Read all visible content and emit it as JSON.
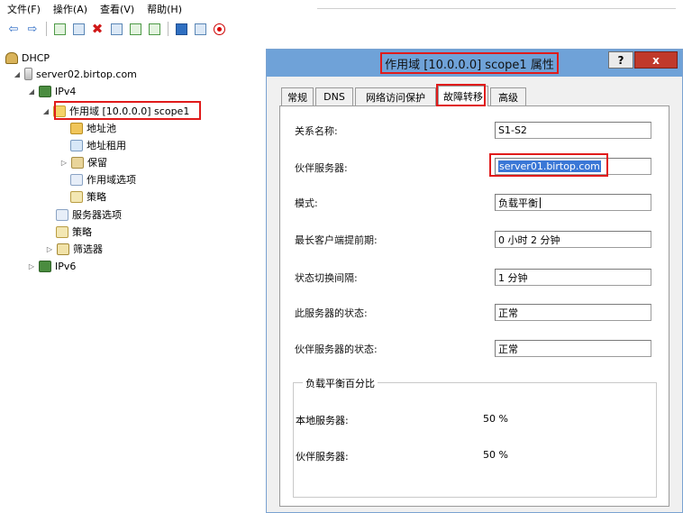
{
  "menu": [
    "文件(F)",
    "操作(A)",
    "查看(V)",
    "帮助(H)"
  ],
  "toolbar": {
    "icons": [
      "back-icon",
      "forward-icon",
      "up-folder-icon",
      "show-hide-tree-icon",
      "delete-icon",
      "properties-icon",
      "refresh-icon",
      "export-icon",
      "help-icon",
      "console-icon",
      "record-icon"
    ]
  },
  "tree": {
    "root": "DHCP",
    "server": "server02.birtop.com",
    "ipv4": "IPv4",
    "scope": "作用域 [10.0.0.0] scope1",
    "address_pool": "地址池",
    "address_leases": "地址租用",
    "reservations": "保留",
    "scope_options": "作用域选项",
    "scope_policies": "策略",
    "server_options": "服务器选项",
    "policies": "策略",
    "filters": "筛选器",
    "ipv6": "IPv6"
  },
  "dialog": {
    "title": "作用域 [10.0.0.0] scope1 属性",
    "help_button": "?",
    "close_button": "x",
    "tabs": [
      "常规",
      "DNS",
      "网络访问保护",
      "故障转移",
      "高级"
    ],
    "active_tab": "故障转移",
    "fields": {
      "relationship_label": "关系名称:",
      "relationship_value": "S1-S2",
      "partner_label": "伙伴服务器:",
      "partner_value": "server01.birtop.com",
      "mode_label": "模式:",
      "mode_value": "负载平衡",
      "mclt_label": "最长客户端提前期:",
      "mclt_value": "0 小时 2 分钟",
      "switchover_label": "状态切换间隔:",
      "switchover_value": "1 分钟",
      "this_state_label": "此服务器的状态:",
      "this_state_value": "正常",
      "partner_state_label": "伙伴服务器的状态:",
      "partner_state_value": "正常"
    },
    "load_balance": {
      "title": "负载平衡百分比",
      "local_label": "本地服务器:",
      "local_value": "50 %",
      "partner_label": "伙伴服务器:",
      "partner_value": "50 %"
    }
  },
  "colors": {
    "highlight_box": "#e01b1b",
    "title_bar": "#6fa2d8",
    "selection": "#3a77d6",
    "close_button": "#c0392b"
  }
}
